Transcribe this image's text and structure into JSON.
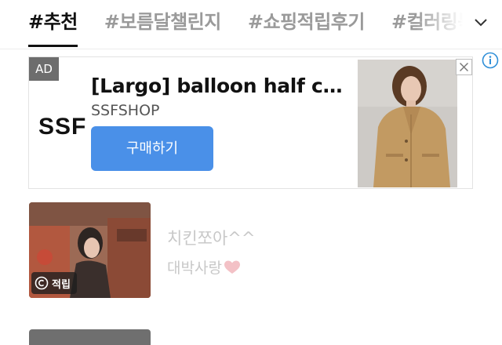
{
  "tabs": [
    {
      "label": "#추천",
      "active": true
    },
    {
      "label": "#보름달챌린지",
      "active": false
    },
    {
      "label": "#쇼핑적립후기",
      "active": false
    },
    {
      "label": "#컬러링북",
      "active": false
    }
  ],
  "ad": {
    "badge": "AD",
    "brand_logo": "SSF",
    "title": "[Largo] balloon half co…",
    "subtitle": "SSFSHOP",
    "button_label": "구매하기"
  },
  "feed": [
    {
      "thumb_badge": "적립",
      "title": "치킨쪼아^^",
      "subtitle": "대박사랑"
    }
  ],
  "icons": [
    "chevron-down-icon",
    "close-icon",
    "info-icon",
    "copyright-icon",
    "heart-icon"
  ],
  "colors": {
    "accent": "#4a90e8",
    "info": "#2f8fd8",
    "active_tab": "#111111",
    "inactive_tab": "#9a9a9a",
    "feed_text": "#c8c8c8"
  }
}
